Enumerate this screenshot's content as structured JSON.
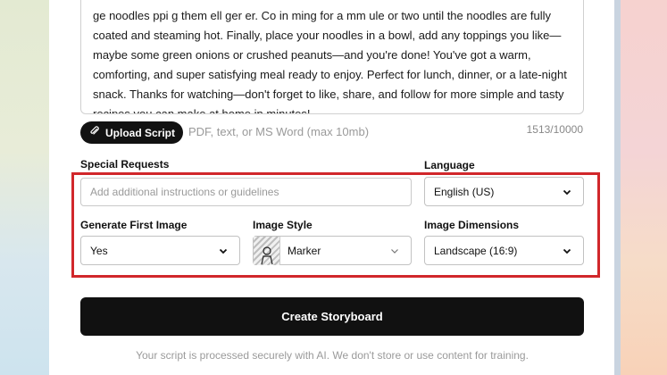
{
  "script": {
    "text": "ge noodles  ppi g them  ell  ger er. Co   in ming for a mm ule or two until\nthe noodles are fully coated and steaming hot. Finally, place your noodles in a bowl, add any toppings you like—maybe some green onions or crushed peanuts—and you're done! You've got a warm, comforting, and super satisfying meal ready to enjoy. Perfect for lunch, dinner, or a late-night snack. Thanks for watching—don't forget to like, share, and follow for more simple and tasty recipes you can make at home in minutes!",
    "char_count": "1513/10000"
  },
  "upload": {
    "label": "Upload Script",
    "hint": "PDF, text, or MS Word (max 10mb)"
  },
  "special_requests": {
    "label": "Special Requests",
    "placeholder": "Add additional instructions or guidelines"
  },
  "language": {
    "label": "Language",
    "value": "English (US)"
  },
  "first_image": {
    "label": "Generate First Image",
    "value": "Yes"
  },
  "image_style": {
    "label": "Image Style",
    "value": "Marker"
  },
  "image_dimensions": {
    "label": "Image Dimensions",
    "value": "Landscape (16:9)"
  },
  "create_button": {
    "label": "Create Storyboard"
  },
  "footer": {
    "note": "Your script is processed securely with AI. We don't store or use content for training."
  },
  "colors": {
    "highlight": "#d1272b",
    "button": "#111111"
  }
}
